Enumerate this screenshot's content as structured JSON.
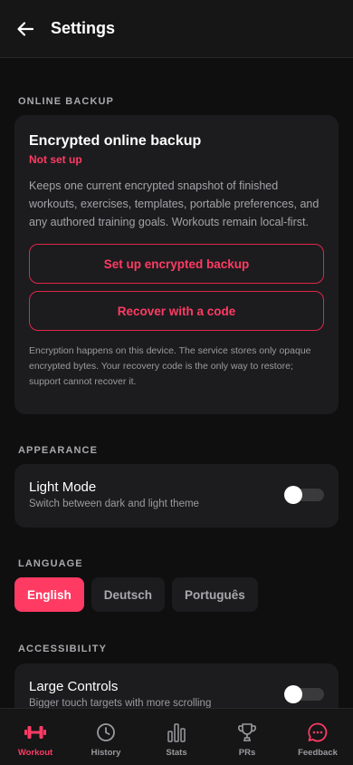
{
  "header": {
    "title": "Settings",
    "back_icon": "arrow-left-icon"
  },
  "online_backup": {
    "section_label": "ONLINE BACKUP",
    "title": "Encrypted online backup",
    "status": "Not set up",
    "description": "Keeps one current encrypted snapshot of finished workouts, exercises, templates, portable preferences, and any authored training goals. Workouts remain local-first.",
    "setup_button": "Set up encrypted backup",
    "recover_button": "Recover with a code",
    "note": "Encryption happens on this device. The service stores only opaque encrypted bytes. Your recovery code is the only way to restore; support cannot recover it."
  },
  "appearance": {
    "section_label": "APPEARANCE",
    "title": "Light Mode",
    "subtitle": "Switch between dark and light theme",
    "enabled": false
  },
  "language": {
    "section_label": "LANGUAGE",
    "options": [
      "English",
      "Deutsch",
      "Português"
    ],
    "selected": "English"
  },
  "accessibility": {
    "section_label": "ACCESSIBILITY",
    "title": "Large Controls",
    "subtitle": "Bigger touch targets with more scrolling",
    "enabled": false
  },
  "tabbar": {
    "tabs": [
      {
        "label": "Workout",
        "icon": "dumbbell-icon",
        "active": true
      },
      {
        "label": "History",
        "icon": "clock-icon",
        "active": false
      },
      {
        "label": "Stats",
        "icon": "bar-chart-icon",
        "active": false
      },
      {
        "label": "PRs",
        "icon": "trophy-icon",
        "active": false
      },
      {
        "label": "Feedback",
        "icon": "chat-bubble-icon",
        "active": false
      }
    ]
  },
  "colors": {
    "accent": "#ff3b64",
    "background": "#0f0f10",
    "card": "#1c1c1e"
  }
}
